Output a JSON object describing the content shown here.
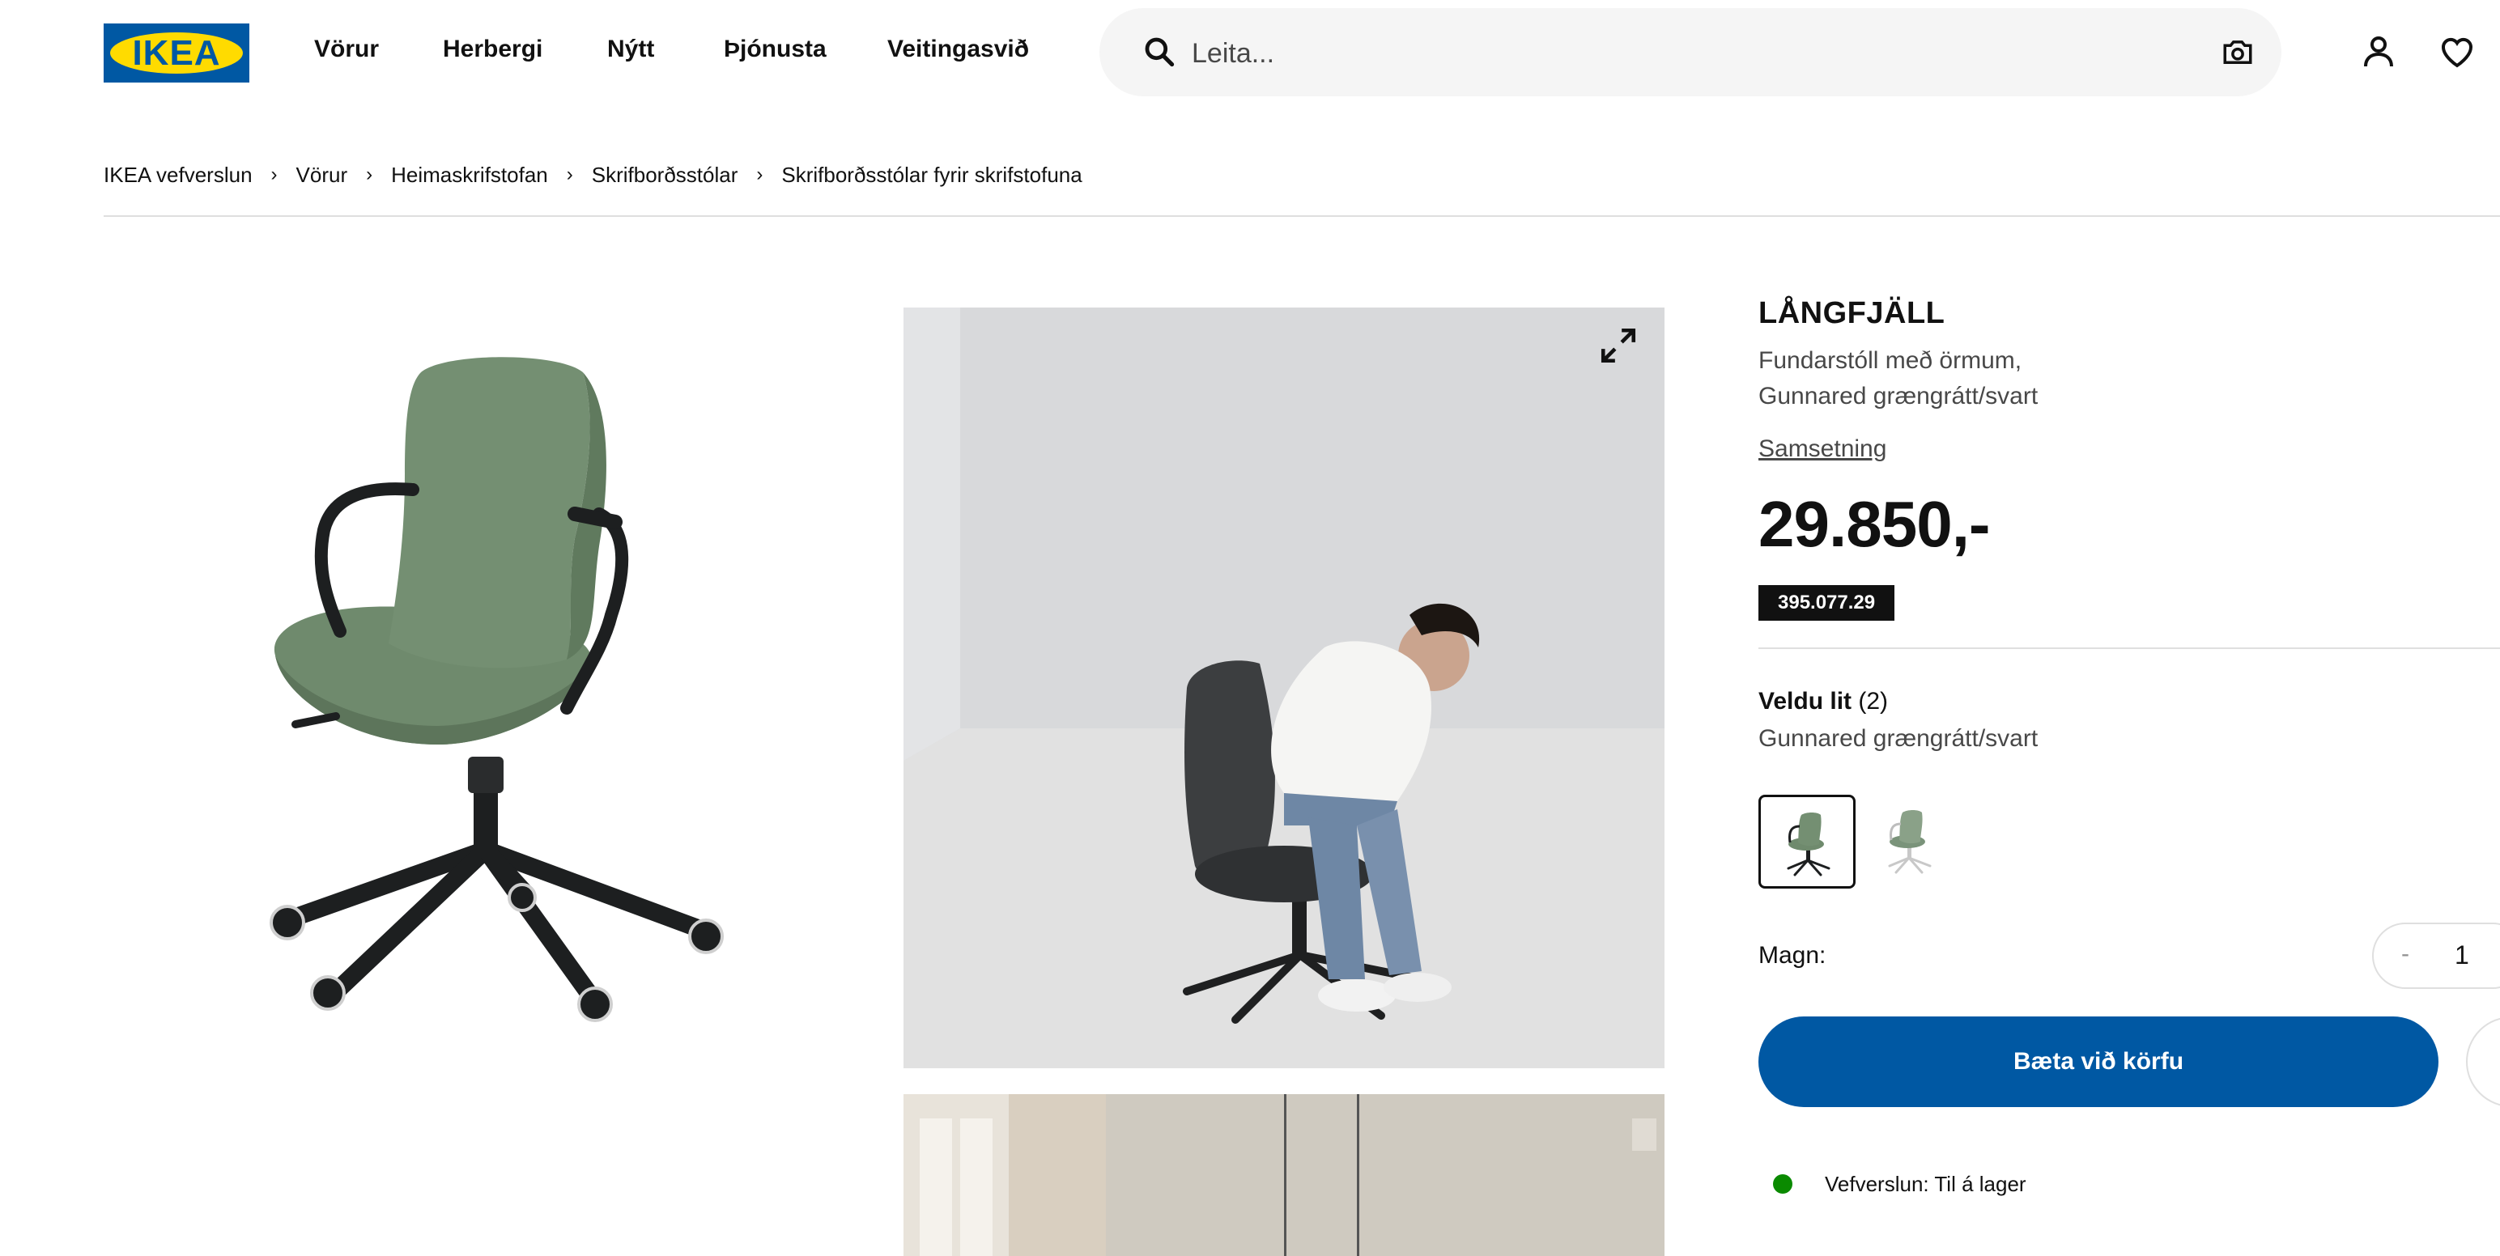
{
  "header": {
    "logo_text": "IKEA",
    "nav": [
      "Vörur",
      "Herbergi",
      "Nýtt",
      "Þjónusta",
      "Veitingasvið"
    ],
    "search_placeholder": "Leita...",
    "icons": [
      "search-icon",
      "camera-icon",
      "account-icon",
      "heart-icon"
    ]
  },
  "breadcrumb": [
    "IKEA vefverslun",
    "Vörur",
    "Heimaskrifstofan",
    "Skrifborðsstólar",
    "Skrifborðsstólar fyrir skrifstofuna"
  ],
  "product": {
    "name": "LÅNGFJÄLL",
    "description_line1": "Fundarstóll með örmum,",
    "description_line2": "Gunnared grængrátt/svart",
    "assembly_link": "Samsetning",
    "price": "29.850,-",
    "article_number": "395.077.29",
    "color_label": "Veldu lit",
    "color_count": "(2)",
    "selected_color": "Gunnared grængrátt/svart",
    "quantity_label": "Magn:",
    "quantity_minus": "-",
    "quantity_value": "1",
    "add_to_cart": "Bæta við körfu",
    "stock_text": "Vefverslun: Til á lager"
  },
  "colors": {
    "ikea_blue": "#0058a3",
    "ikea_yellow": "#ffdb00",
    "seat_green": "#6f8a6d",
    "stock_green": "#0a8a00"
  }
}
